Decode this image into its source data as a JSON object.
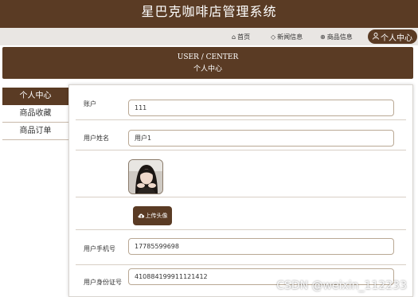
{
  "app": {
    "title": "星巴克咖啡店管理系统"
  },
  "nav": {
    "home": {
      "icon": "home-icon",
      "label": "首页"
    },
    "news": {
      "icon": "tag-icon",
      "label": "新闻信息"
    },
    "goods": {
      "icon": "globe-icon",
      "label": "商品信息"
    },
    "center": {
      "icon": "user-icon",
      "label": "个人中心"
    }
  },
  "banner": {
    "en": "USER / CENTER",
    "cn": "个人中心"
  },
  "sidebar": {
    "items": [
      {
        "label": "个人中心",
        "active": true
      },
      {
        "label": "商品收藏",
        "active": false
      },
      {
        "label": "商品订单",
        "active": false
      }
    ]
  },
  "form": {
    "account_label": "账户",
    "account_value": "111",
    "name_label": "用户姓名",
    "name_value": "用户1",
    "upload_icon": "cloud-upload-icon",
    "upload_label": "上传头像",
    "phone_label": "用户手机号",
    "phone_value": "17785599698",
    "idcard_label": "用户身份证号",
    "idcard_value": "410884199911121412"
  },
  "watermark": "CSDN @weixin_112233",
  "colors": {
    "brand": "#5a3b24",
    "nav_bg": "#e9e6e3",
    "border": "#b9a894"
  }
}
